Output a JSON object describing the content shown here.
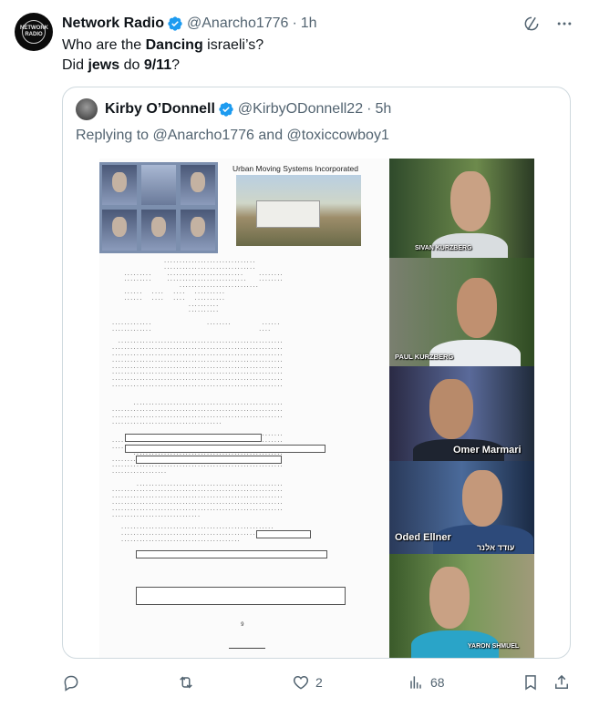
{
  "author": {
    "name": "Network Radio",
    "handle": "@Anarcho1776",
    "time": "1h",
    "avatar_text": "NETWORK RADIO"
  },
  "post": {
    "line1_pre": "Who are the ",
    "line1_bold": "Dancing",
    "line1_post": " israeli’s?",
    "line2_pre": "Did ",
    "line2_bold1": "jews",
    "line2_mid": " do ",
    "line2_bold2": "9/11",
    "line2_post": "?"
  },
  "quoted": {
    "name": "Kirby O’Donnell",
    "handle": "@KirbyODonnell22",
    "time": "5h",
    "replying_to": "Replying to",
    "mention1": "@Anarcho1776",
    "and_text": "and",
    "mention2": "@toxiccowboy1"
  },
  "media": {
    "company_title": "Urban Moving Systems Incorporated",
    "page_number": "9",
    "captions": [
      "SIVAN KURZBERG",
      "PAUL KURZBERG",
      "Omer Marmari",
      "Oded Ellner",
      "YARON SHMUEL"
    ],
    "hebrew_caption": "עודד אלנר"
  },
  "actions": {
    "replies": "",
    "reposts": "",
    "likes": "2",
    "views": "68"
  },
  "icons": {
    "verified": "verified-badge-icon",
    "grok": "grok-icon",
    "more": "more-icon",
    "reply": "reply-icon",
    "repost": "repost-icon",
    "like": "heart-icon",
    "views": "views-icon",
    "bookmark": "bookmark-icon",
    "share": "share-icon"
  },
  "colors": {
    "verified": "#1d9bf0",
    "secondary_text": "#536471",
    "border": "#cfd9de"
  }
}
